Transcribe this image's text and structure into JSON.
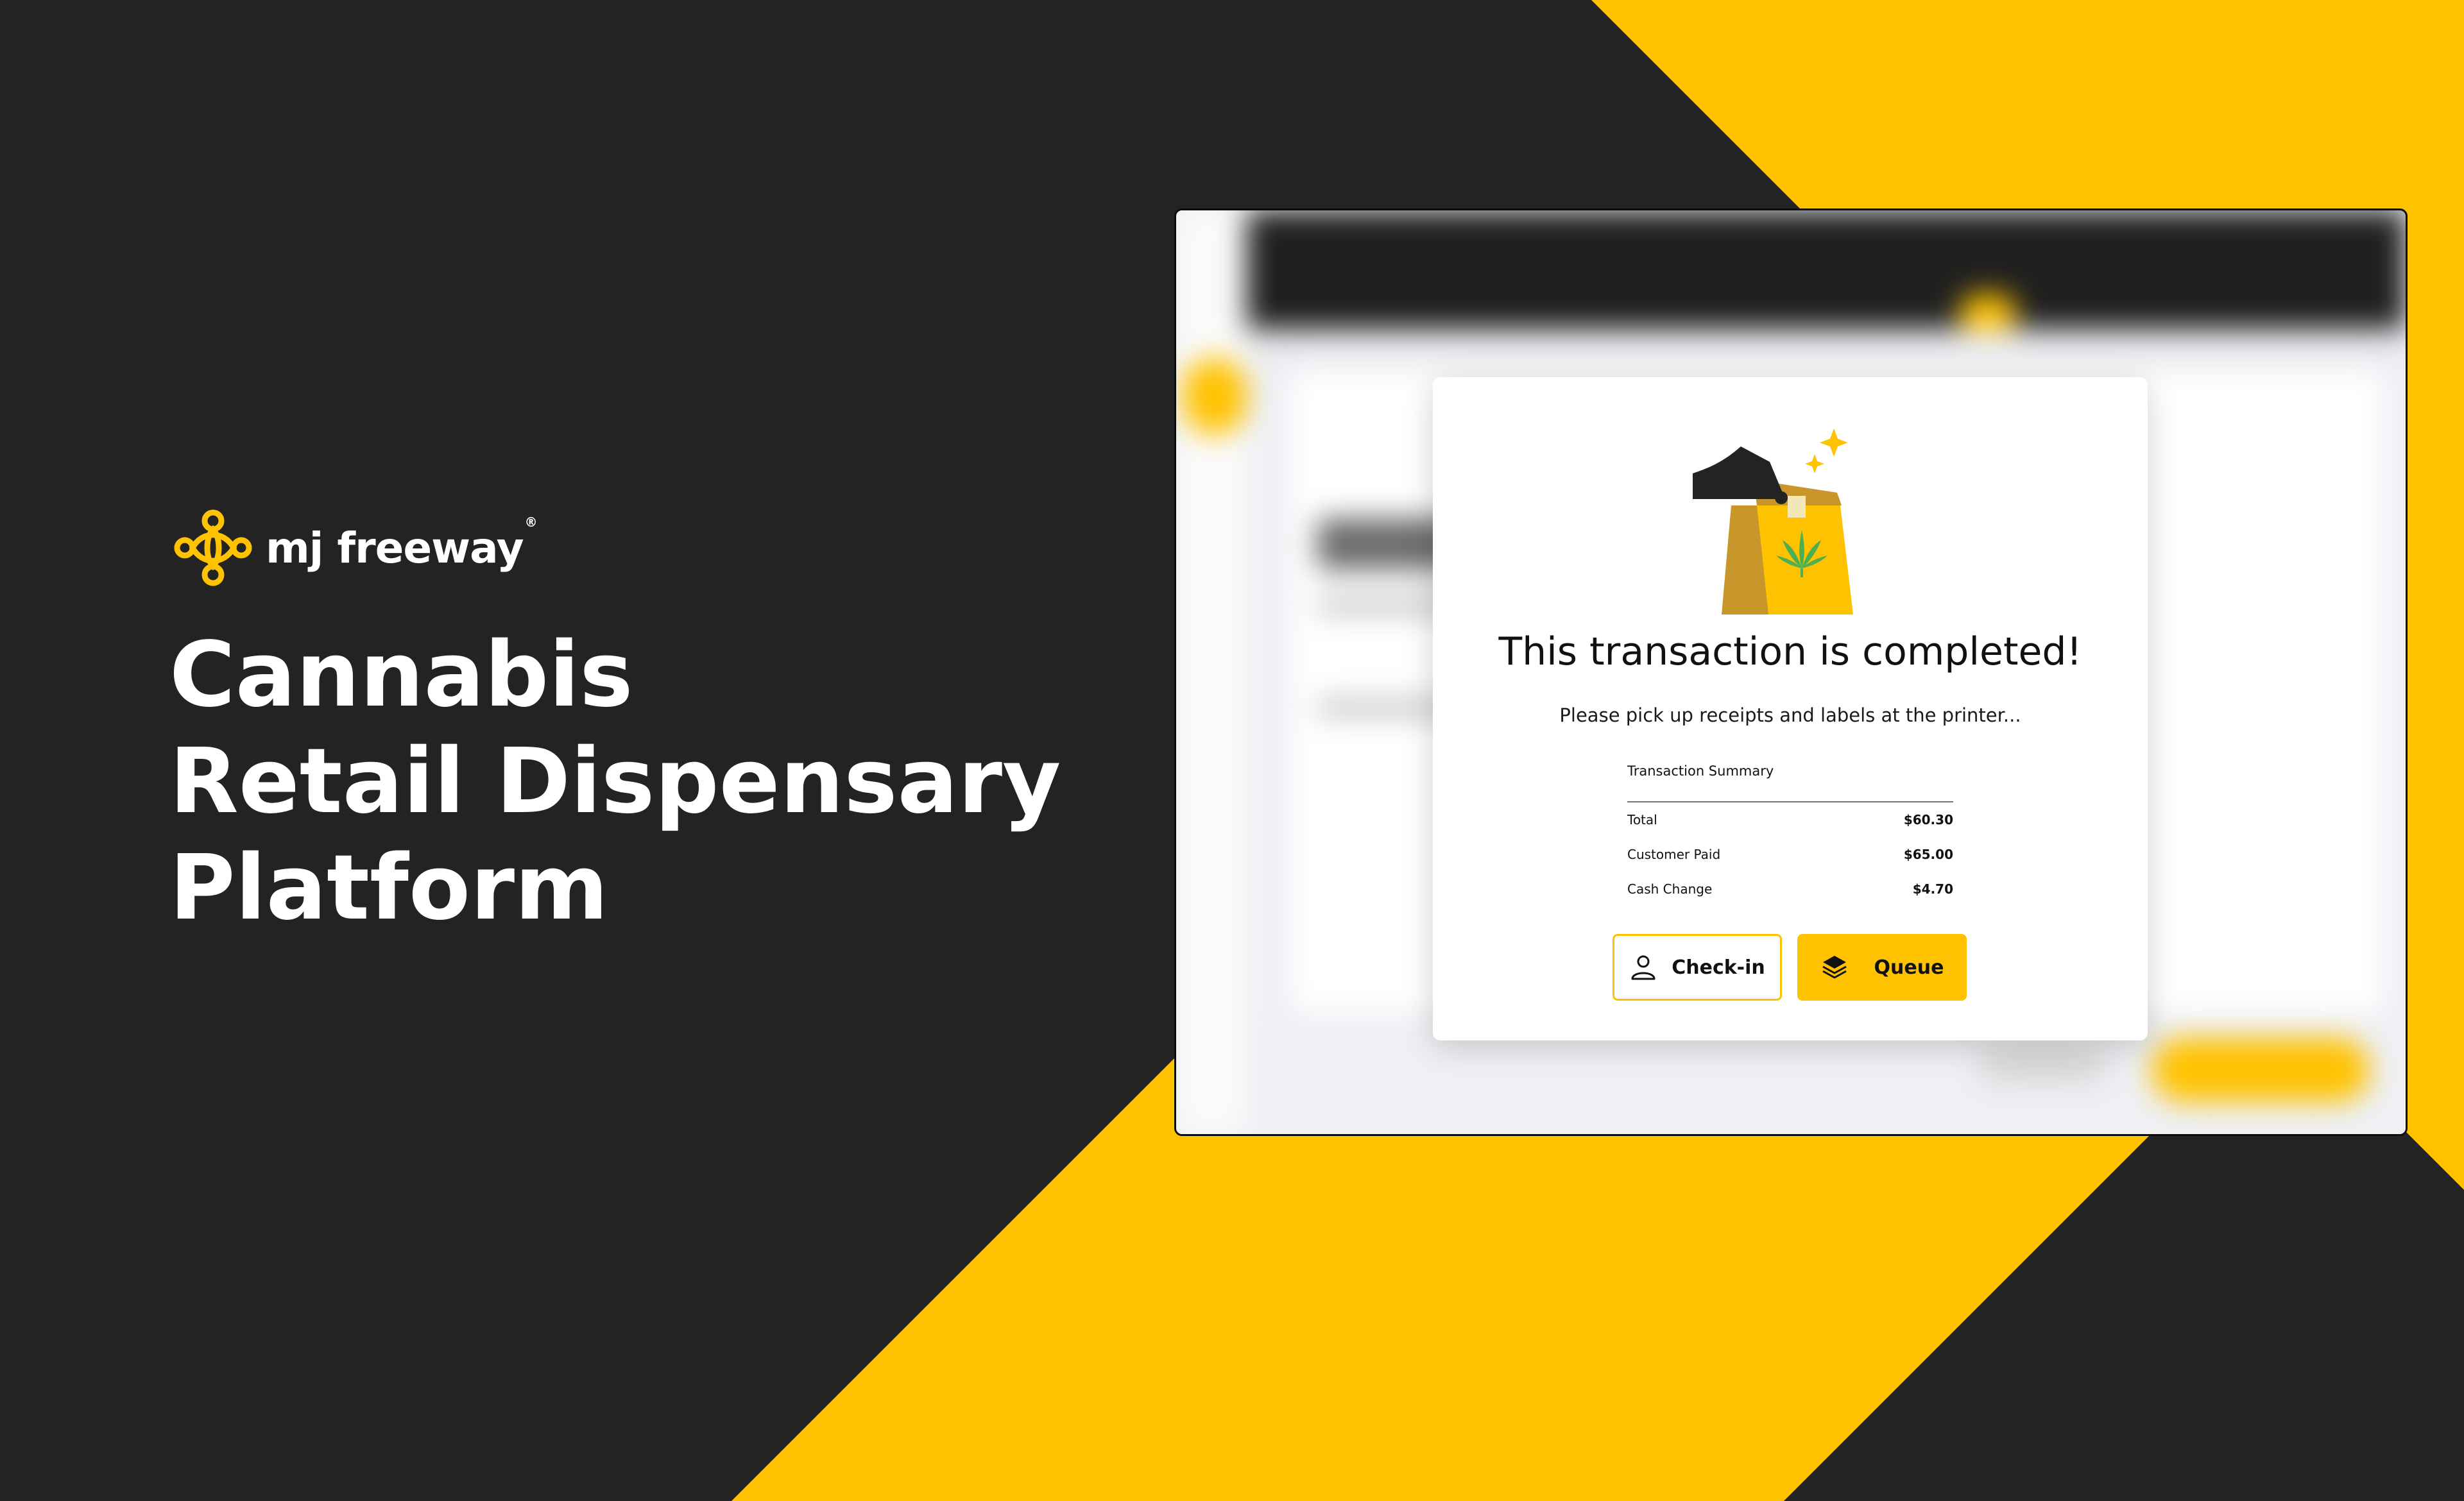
{
  "brand": {
    "name": "mj freeway",
    "registered_mark": "®",
    "accent_color": "#FFC200",
    "background_color": "#232323"
  },
  "hero": {
    "lines": [
      "Cannabis",
      "Retail Dispensary",
      "Platform"
    ]
  },
  "modal": {
    "title": "This transaction is completed!",
    "subtitle": "Please pick up receipts and labels at the printer...",
    "illustration_icon": "shopping-bag-cannabis-icon",
    "summary": {
      "title": "Transaction Summary",
      "rows": [
        {
          "label": "Total",
          "value": "$60.30"
        },
        {
          "label": "Customer Paid",
          "value": "$65.00"
        },
        {
          "label": "Cash Change",
          "value": "$4.70"
        }
      ]
    },
    "buttons": {
      "checkin": {
        "label": "Check-in",
        "icon": "user-icon"
      },
      "queue": {
        "label": "Queue",
        "icon": "layers-icon"
      }
    }
  }
}
